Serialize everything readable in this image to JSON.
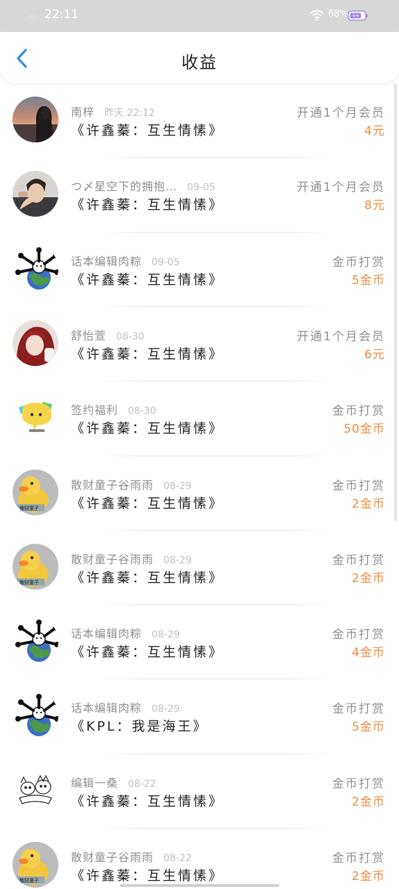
{
  "status_bar": {
    "time": "22:11",
    "signal": ".ıll",
    "battery_percent": "68%",
    "colors": {
      "background": "#d8d8d8",
      "battery": "#a88be0"
    }
  },
  "header": {
    "title": "收益",
    "back_icon": "chevron-left-icon",
    "accent_color": "#2f8de4"
  },
  "colors": {
    "amount": "#f08a3c",
    "muted": "#8f8f8f"
  },
  "records": [
    {
      "avatar": "girl-sunset-photo",
      "user": "南梓",
      "time": "昨天 22:12",
      "book": "《许鑫蓁：互生情愫》",
      "type": "开通1个月会员",
      "amount": "4元"
    },
    {
      "avatar": "boy-selfie-photo",
      "user": "つ〆星空下的拥抱…",
      "time": "09-05",
      "book": "《许鑫蓁：互生情愫》",
      "type": "开通1个月会员",
      "amount": "8元"
    },
    {
      "avatar": "earth-figure-sticker",
      "user": "话本编辑肉粽",
      "time": "09-05",
      "book": "《许鑫蓁：互生情愫》",
      "type": "金币打赏",
      "amount": "5金币"
    },
    {
      "avatar": "red-hair-anime-girl",
      "user": "舒怡萱",
      "time": "08-30",
      "book": "《许鑫蓁：互生情愫》",
      "type": "开通1个月会员",
      "amount": "6元"
    },
    {
      "avatar": "yellow-chat-bubble",
      "user": "签约福利",
      "time": "08-30",
      "book": "《许鑫蓁：互生情愫》",
      "type": "金币打赏",
      "amount": "50金币"
    },
    {
      "avatar": "yellow-duck",
      "user": "散财童子谷雨雨",
      "time": "08-29",
      "book": "《许鑫蓁：互生情愫》",
      "type": "金币打赏",
      "amount": "2金币"
    },
    {
      "avatar": "yellow-duck",
      "user": "散财童子谷雨雨",
      "time": "08-29",
      "book": "《许鑫蓁：互生情愫》",
      "type": "金币打赏",
      "amount": "2金币"
    },
    {
      "avatar": "earth-figure-sticker",
      "user": "话本编辑肉粽",
      "time": "08-29",
      "book": "《许鑫蓁：互生情愫》",
      "type": "金币打赏",
      "amount": "4金币"
    },
    {
      "avatar": "earth-figure-sticker",
      "user": "话本编辑肉粽",
      "time": "08-29",
      "book": "《KPL：我是海王》",
      "type": "金币打赏",
      "amount": "5金币"
    },
    {
      "avatar": "sketch-doodle",
      "user": "编辑一桑",
      "time": "08-22",
      "book": "《许鑫蓁：互生情愫》",
      "type": "金币打赏",
      "amount": "2金币"
    },
    {
      "avatar": "yellow-duck",
      "user": "散财童子谷雨雨",
      "time": "08-22",
      "book": "《许鑫蓁：互生情愫》",
      "type": "金币打赏",
      "amount": "2金币"
    }
  ]
}
